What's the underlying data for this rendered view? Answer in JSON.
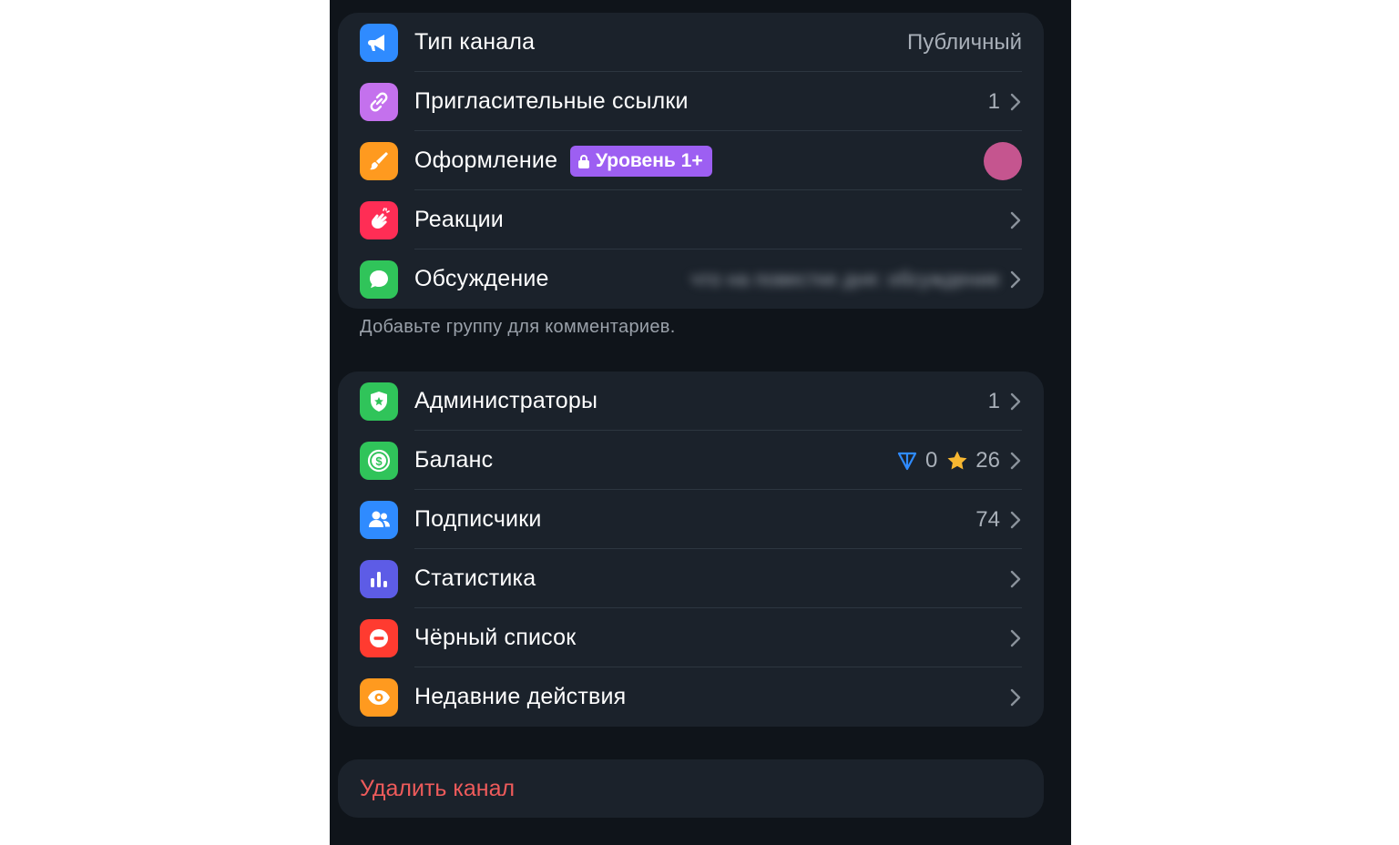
{
  "section1": {
    "rows": [
      {
        "label": "Тип канала",
        "value": "Публичный",
        "icon": "megaphone-icon",
        "color": "#2f8bff"
      },
      {
        "label": "Пригласительные ссылки",
        "value": "1",
        "icon": "link-icon",
        "color": "#c471ed"
      },
      {
        "label": "Оформление",
        "badge": "Уровень 1+",
        "icon": "brush-icon",
        "color": "#ff9a1f",
        "swatch": "#c5558f"
      },
      {
        "label": "Реакции",
        "icon": "clapping-hands-icon",
        "color": "#ff2d55"
      },
      {
        "label": "Обсуждение",
        "value": "что на повестке дня: обсуждение",
        "icon": "chat-bubble-icon",
        "color": "#30c45a"
      }
    ],
    "footnote": "Добавьте группу для комментариев."
  },
  "section2": {
    "rows": [
      {
        "label": "Администраторы",
        "value": "1",
        "icon": "shield-star-icon",
        "color": "#30c45a"
      },
      {
        "label": "Баланс",
        "ton": "0",
        "stars": "26",
        "icon": "dollar-coin-icon",
        "color": "#30c45a"
      },
      {
        "label": "Подписчики",
        "value": "74",
        "icon": "people-icon",
        "color": "#2f8bff"
      },
      {
        "label": "Статистика",
        "icon": "bar-chart-icon",
        "color": "#5d5ce6"
      },
      {
        "label": "Чёрный список",
        "icon": "minus-circle-icon",
        "color": "#ff3b30"
      },
      {
        "label": "Недавние действия",
        "icon": "eye-icon",
        "color": "#ff9a1f"
      }
    ]
  },
  "danger": {
    "label": "Удалить канал",
    "color": "#ef5b5b"
  }
}
